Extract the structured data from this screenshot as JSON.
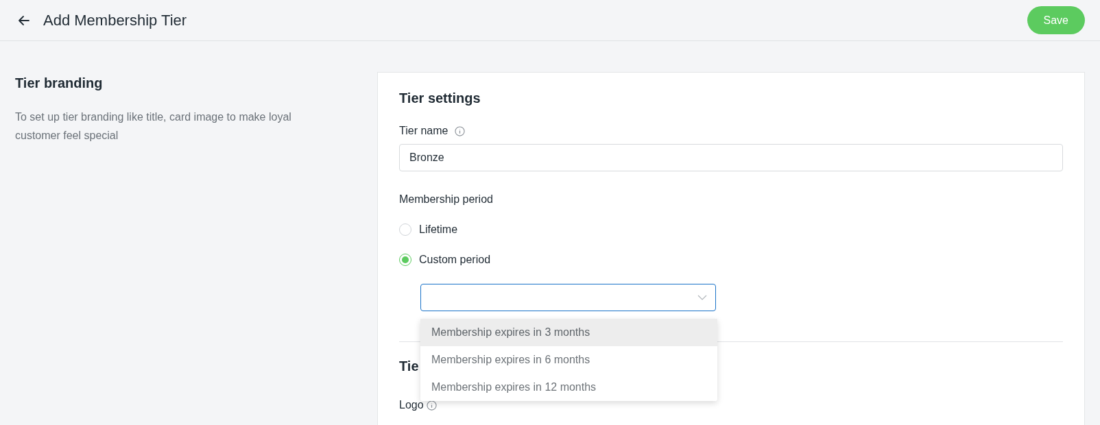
{
  "header": {
    "title": "Add Membership Tier",
    "save_button": "Save"
  },
  "branding": {
    "title": "Tier branding",
    "description": "To set up tier branding like title, card image to make loyal customer feel special"
  },
  "settings": {
    "title": "Tier settings",
    "tier_name": {
      "label": "Tier name",
      "value": "Bronze"
    },
    "membership_period": {
      "label": "Membership period",
      "options": [
        {
          "label": "Lifetime",
          "selected": false
        },
        {
          "label": "Custom period",
          "selected": true
        }
      ],
      "period_select": {
        "focused": true,
        "options": [
          {
            "label": "Membership expires in 3 months",
            "highlighted": true
          },
          {
            "label": "Membership expires in 6 months",
            "highlighted": false
          },
          {
            "label": "Membership expires in 12 months",
            "highlighted": false
          }
        ]
      }
    }
  },
  "next_section": {
    "title": "Tie",
    "logo_label": "Logo"
  }
}
